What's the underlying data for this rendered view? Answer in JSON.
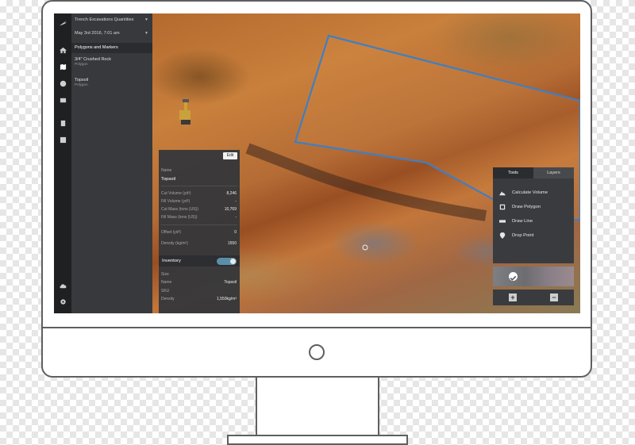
{
  "sidebar": {
    "project_title": "Trench Excavations Quantities",
    "date": "May 3rd 2016, 7:01 am",
    "section_header": "Polygons and Markers",
    "items": [
      {
        "name": "3/4\" Crushed Rock",
        "type": "Polygon"
      },
      {
        "name": "Topsoil",
        "type": "Polygon"
      }
    ]
  },
  "icon_rail": {
    "icons": [
      "logo-icon",
      "home-icon",
      "map-icon",
      "globe-icon",
      "image-icon",
      "document-icon",
      "report-icon",
      "cloud-upload-icon",
      "gear-icon"
    ]
  },
  "details": {
    "edit_label": "Edit",
    "name_label": "Name",
    "name_value": "Topsoil",
    "cut_volume_label": "Cut Volume (yd³)",
    "cut_volume_value": "8,246",
    "fill_volume_label": "Fill Volume (yd³)",
    "fill_volume_value": "-",
    "cut_mass_label": "Cut Mass (tons (US))",
    "cut_mass_value": "10,769",
    "fill_mass_label": "Fill Mass (tons (US))",
    "fill_mass_value": "-",
    "offset_label": "Offset (yd³)",
    "offset_value": "0",
    "density_label": "Density (kg/m³)",
    "density_value": "1550",
    "inventory_label": "Inventory",
    "inventory_enabled": true,
    "size_label": "Size",
    "inv_name_label": "Name",
    "inv_name_value": "Topsoil",
    "sku_label": "SKU",
    "inv_density_label": "Density",
    "inv_density_value": "1,550kg/m³"
  },
  "tools_panel": {
    "tabs": [
      "Tools",
      "Layers"
    ],
    "active_tab": "Tools",
    "items": [
      {
        "label": "Calculate Volume",
        "icon": "mountain-icon"
      },
      {
        "label": "Draw Polygon",
        "icon": "square-icon"
      },
      {
        "label": "Draw Line",
        "icon": "ruler-icon"
      },
      {
        "label": "Drop Point",
        "icon": "pin-icon"
      }
    ]
  },
  "zoom": {
    "in_label": "+",
    "out_label": "−"
  },
  "colors": {
    "accent": "#3f7fc4",
    "toggle": "#5b8fa8",
    "panel": "#38393c",
    "rail": "#1f2022"
  }
}
